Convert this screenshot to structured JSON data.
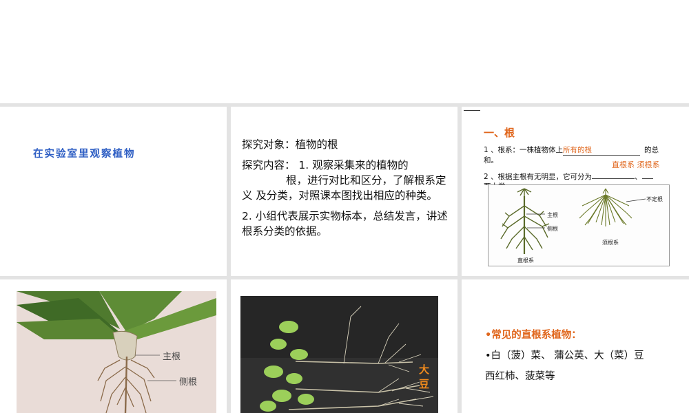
{
  "slides": {
    "s1": {
      "title": "在实验室里观察植物"
    },
    "s2": {
      "object": "探究对象：植物的根",
      "content_a": "探究内容： 1. 观察采集来的植物的",
      "content_b": "根，进行对比和区分，了解根系定义 及分类，对照课本图找出相应的种类。",
      "step2": "2. 小组代表展示实物标本，总结发言，讲述根系分类的依据。"
    },
    "s3": {
      "heading": "一、根",
      "l1_pre": "1 、根系：一株植物体上",
      "l1_fill": "所有的根",
      "l1_post": "的总",
      "l1_wrap": "和。",
      "fill2": "直根系  须根系",
      "l2": "2 、根据主根有无明显，它可分为",
      "l2_sep": "、",
      "l2_wrap": "两大类。",
      "fig_labels": {
        "main_root": "主根",
        "side_root": "侧根",
        "taproot_system": "直根系",
        "adventitious": "不定根",
        "fibrous_system": "须根系"
      }
    },
    "s4": {
      "main_root": "主根",
      "side_root": "侧根"
    },
    "s5": {
      "label": "大豆"
    },
    "s6": {
      "heading": "•常见的直根系植物：",
      "items_line1": "•白（菠）菜、 蒲公英、大（菜）豆",
      "items_line2": "西红柿、菠菜等"
    }
  },
  "colors": {
    "accent_orange": "#e0661c",
    "title_blue": "#2f5fc4",
    "grid_gray": "#e3e3e3"
  }
}
